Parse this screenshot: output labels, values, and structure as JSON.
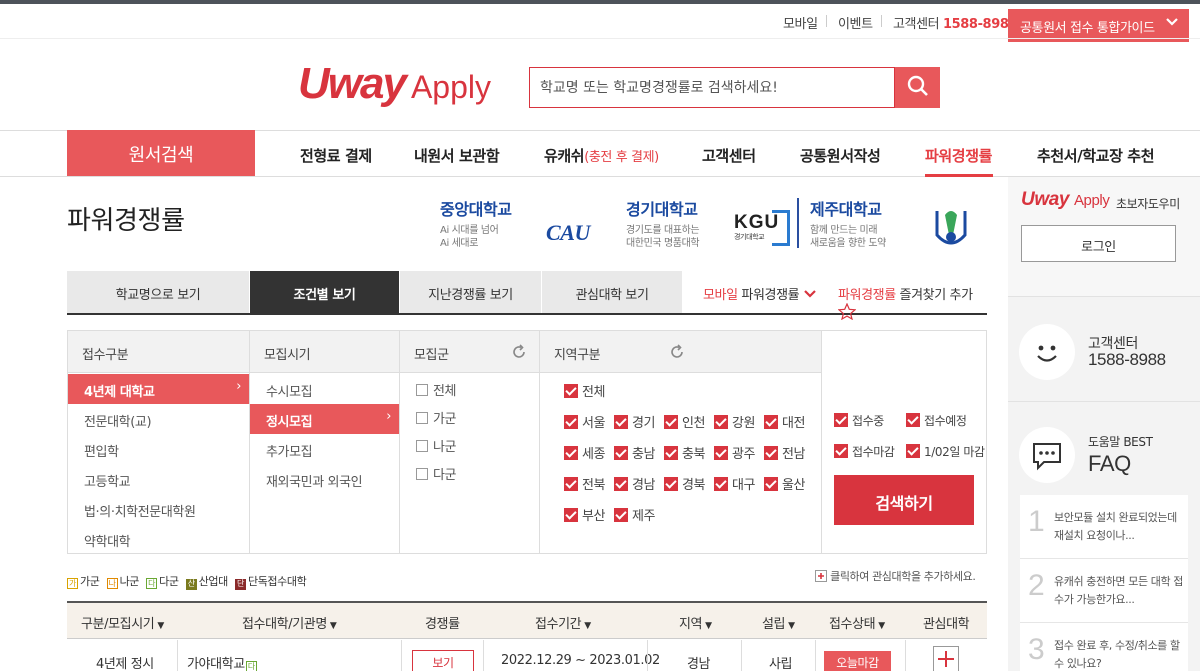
{
  "utility": {
    "mobile": "모바일",
    "event": "이벤트",
    "cs_label": "고객센터",
    "cs_phone": "1588-8988",
    "guide": "공통원서 접수 통합가이드"
  },
  "header": {
    "logo_u": "Uway",
    "logo_apply": "Apply",
    "search_placeholder": "학교명 또는 학교명경쟁률로 검색하세요!"
  },
  "gnb": {
    "main": "원서검색",
    "items": [
      {
        "label": "전형료 결제",
        "sub": ""
      },
      {
        "label": "내원서 보관함",
        "sub": ""
      },
      {
        "label": "유캐쉬",
        "sub": "(충전 후 결제)"
      },
      {
        "label": "고객센터",
        "sub": ""
      },
      {
        "label": "공통원서작성",
        "sub": ""
      },
      {
        "label": "파워경쟁률",
        "sub": ""
      },
      {
        "label": "추천서/학교장 추천",
        "sub": ""
      }
    ]
  },
  "page_title": "파워경쟁률",
  "banners": [
    {
      "name": "중앙대학교",
      "sub1": "Ai 시대를 넘어",
      "sub2": "Ai 세대로",
      "logo": "CAU"
    },
    {
      "name": "경기대학교",
      "sub1": "경기도를 대표하는",
      "sub2": "대한민국 명품대학",
      "logo": "KGU",
      "logo_sub": "경기대학교"
    },
    {
      "name": "제주대학교",
      "sub1": "함께 만드는 미래",
      "sub2": "새로움을 향한 도약"
    }
  ],
  "tabs": [
    "학교명으로 보기",
    "조건별 보기",
    "지난경쟁률 보기",
    "관심대학 보기"
  ],
  "tab_links": {
    "mobile_prefix": "모바일",
    "mobile_label": "파워경쟁률",
    "fav_prefix": "파워경쟁률",
    "fav_label": "즐겨찾기 추가"
  },
  "filter": {
    "heads": [
      "접수구분",
      "모집시기",
      "모집군",
      "지역구분"
    ],
    "types": [
      "4년제 대학교",
      "전문대학(교)",
      "편입학",
      "고등학교",
      "법·의·치학전문대학원",
      "약학대학"
    ],
    "periods": [
      "수시모집",
      "정시모집",
      "추가모집",
      "재외국민과 외국인"
    ],
    "groups": [
      "전체",
      "가군",
      "나군",
      "다군"
    ],
    "region_all": "전체",
    "regions": [
      "서울",
      "경기",
      "인천",
      "강원",
      "대전",
      "세종",
      "충남",
      "충북",
      "광주",
      "전남",
      "전북",
      "경남",
      "경북",
      "대구",
      "울산",
      "부산",
      "제주"
    ],
    "statuses": [
      "접수중",
      "접수예정",
      "접수마감",
      "1/02일 마감"
    ],
    "submit": "검색하기"
  },
  "legend": {
    "items": [
      {
        "mark": "가",
        "label": "가군",
        "color": "#d9a300"
      },
      {
        "mark": "나",
        "label": "나군",
        "color": "#e08a00"
      },
      {
        "mark": "다",
        "label": "다군",
        "color": "#6aa832"
      },
      {
        "mark": "산",
        "label": "산업대",
        "color": "#7a7a1e"
      },
      {
        "mark": "단",
        "label": "단독접수대학",
        "color": "#8b2a2a"
      }
    ],
    "add_note": "클릭하여 관심대학을 추가하세요."
  },
  "table": {
    "headers": [
      "구분/모집시기",
      "접수대학/기관명",
      "경쟁률",
      "접수기간",
      "지역",
      "설립",
      "접수상태",
      "관심대학"
    ],
    "rows": [
      {
        "type": "4년제 정시",
        "name": "가야대학교",
        "mark": "다",
        "view": "보기",
        "period": "2022.12.29 ~ 2023.01.02",
        "region": "경남",
        "found": "사립",
        "status": "오늘마감"
      }
    ]
  },
  "aside": {
    "logo_u": "Uway",
    "logo_apply": "Apply",
    "help": "초보자도우미",
    "login": "로그인",
    "cs_label": "고객센터",
    "cs_phone": "1588-8988",
    "faq_title1": "도움말 BEST",
    "faq_title2": "FAQ",
    "faq": [
      {
        "num": "1",
        "text": "보안모듈 설치 완료되었는데 재설치 요청이나..."
      },
      {
        "num": "2",
        "text": "유캐쉬 충전하면 모든 대학 접수가 가능한가요..."
      },
      {
        "num": "3",
        "text": "접수 완료 후, 수정/취소를 할 수 있나요?"
      }
    ]
  },
  "colors": {
    "accent": "#e8585b",
    "brand": "#d8343e",
    "dark": "#333333"
  }
}
